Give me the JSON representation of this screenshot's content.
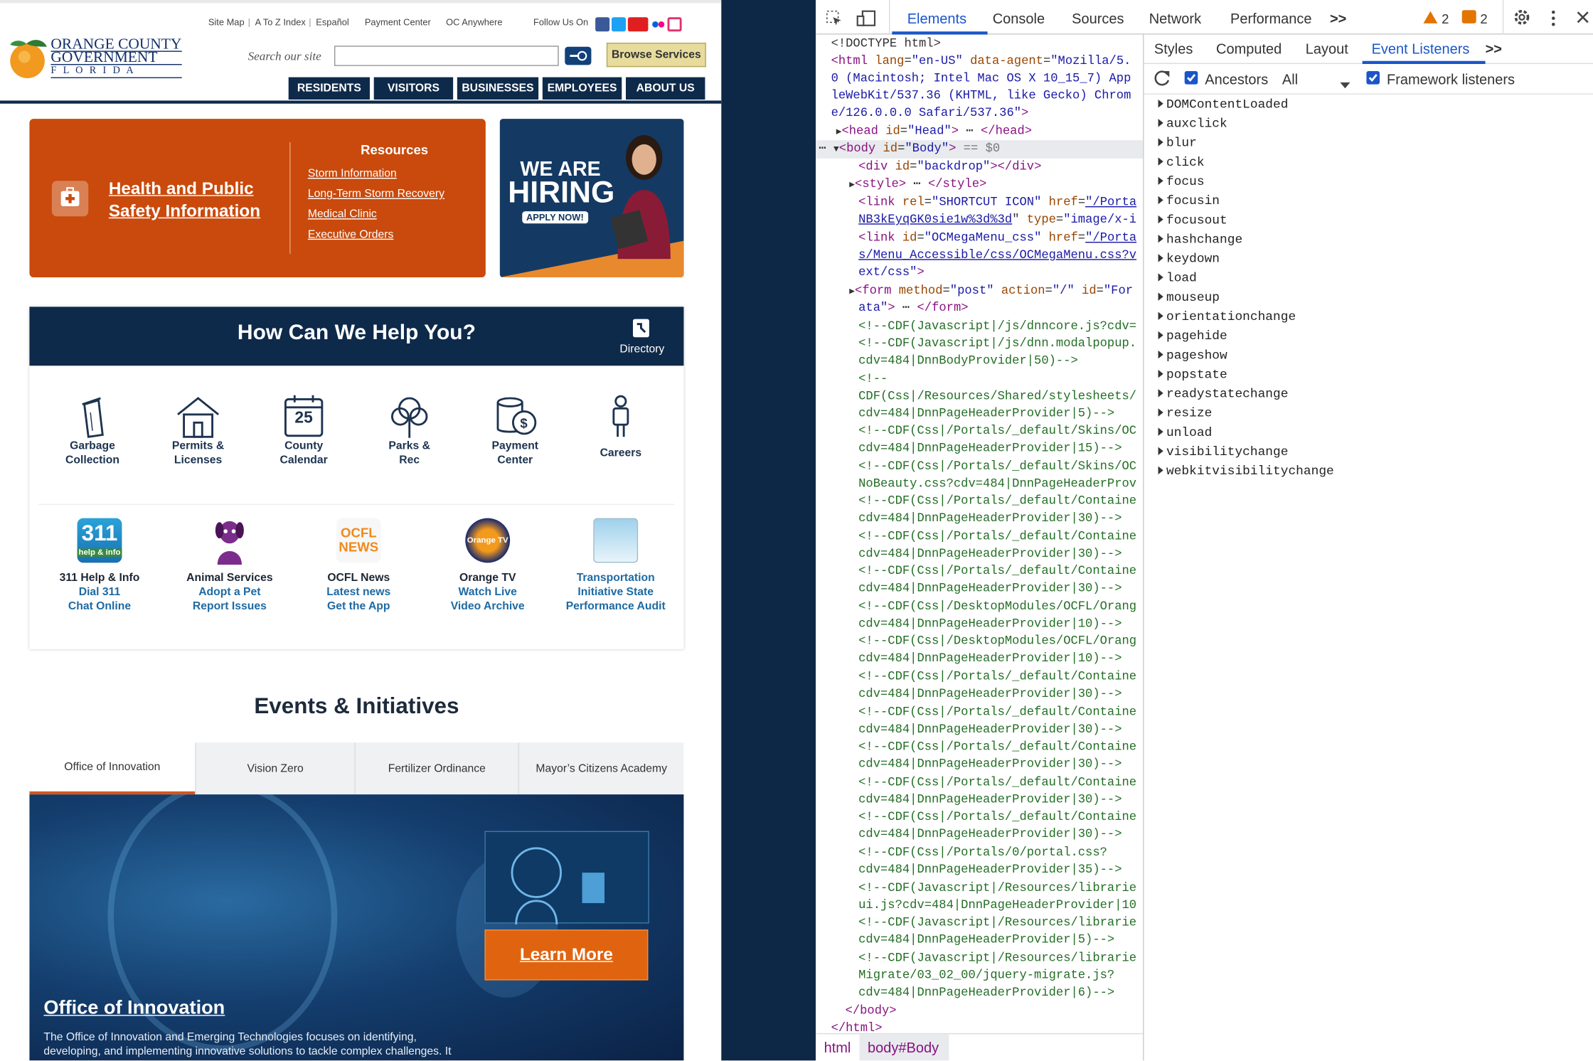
{
  "site": {
    "toplinks": [
      "Site Map",
      "|",
      "A To Z Index",
      "|",
      "Español",
      "Payment Center",
      "OC Anywhere",
      "Follow Us On"
    ],
    "logo": {
      "line1": "ORANGE COUNTY",
      "line2": "GOVERNMENT",
      "line3": "F L O R I D A"
    },
    "search_label": "Search our site",
    "browse": "Browse Services",
    "nav": [
      "RESIDENTS",
      "VISITORS",
      "BUSINESSES",
      "EMPLOYEES",
      "ABOUT US"
    ],
    "health_title": "Health and Public Safety Information",
    "resources_title": "Resources",
    "resources": [
      "Storm Information",
      "Long-Term Storm Recovery",
      "Medical Clinic",
      "Executive Orders"
    ],
    "hiring": {
      "line1": "WE ARE",
      "line2": "HIRING",
      "cta": "APPLY NOW!"
    },
    "help_title": "How Can We Help You?",
    "directory": "Directory",
    "help_items": [
      {
        "icon": "trash-can-icon",
        "l1": "Garbage",
        "l2": "Collection"
      },
      {
        "icon": "house-icon",
        "l1": "Permits &",
        "l2": "Licenses"
      },
      {
        "icon": "calendar-icon",
        "l1": "County",
        "l2": "Calendar",
        "num": "25"
      },
      {
        "icon": "tree-icon",
        "l1": "Parks &",
        "l2": "Rec"
      },
      {
        "icon": "coins-icon",
        "l1": "Payment",
        "l2": "Center"
      },
      {
        "icon": "person-icon",
        "l1": "Careers",
        "l2": ""
      }
    ],
    "apps": [
      {
        "icon": "311-app-icon",
        "badge": "311",
        "badge_sub": "help & info",
        "t": "311 Help & Info",
        "a": "Dial 311",
        "b": "Chat Online"
      },
      {
        "icon": "pet-icon",
        "t": "Animal Services",
        "a": "Adopt a Pet",
        "b": "Report Issues"
      },
      {
        "icon": "ocfl-news-icon",
        "badge": "OCFL",
        "badge_sub": "NEWS",
        "t": "OCFL News",
        "a": "Latest news",
        "b": "Get the App"
      },
      {
        "icon": "orange-tv-icon",
        "badge": "Orange TV",
        "t": "Orange TV",
        "a": "Watch Live",
        "b": "Video Archive"
      },
      {
        "icon": "report-icon",
        "t": "",
        "a": "Transportation",
        "b": "Initiative State",
        "c": "Performance Audit"
      }
    ],
    "events_title": "Events & Initiatives",
    "tabs": [
      "Office of Innovation",
      "Vision Zero",
      "Fertilizer Ordinance",
      "Mayor’s Citizens Academy"
    ],
    "learn_more": "Learn More",
    "innov_title": "Office of Innovation",
    "innov_text1": "The Office of Innovation and Emerging Technologies focuses on identifying,",
    "innov_text2": "developing, and implementing innovative solutions to tackle complex challenges. It"
  },
  "devtools": {
    "tabs": [
      "Elements",
      "Console",
      "Sources",
      "Network",
      "Performance",
      ">>"
    ],
    "warn_count": "2",
    "err_count": "2",
    "side_tabs": [
      "Styles",
      "Computed",
      "Layout",
      "Event Listeners",
      ">>"
    ],
    "ancestors": "Ancestors",
    "all": "All",
    "framework": "Framework listeners",
    "events": [
      "DOMContentLoaded",
      "auxclick",
      "blur",
      "click",
      "focus",
      "focusin",
      "focusout",
      "hashchange",
      "keydown",
      "load",
      "mouseup",
      "orientationchange",
      "pagehide",
      "pageshow",
      "popstate",
      "readystatechange",
      "resize",
      "unload",
      "visibilitychange",
      "webkitvisibilitychange"
    ],
    "breadcrumb": [
      "html",
      "body#Body"
    ]
  }
}
